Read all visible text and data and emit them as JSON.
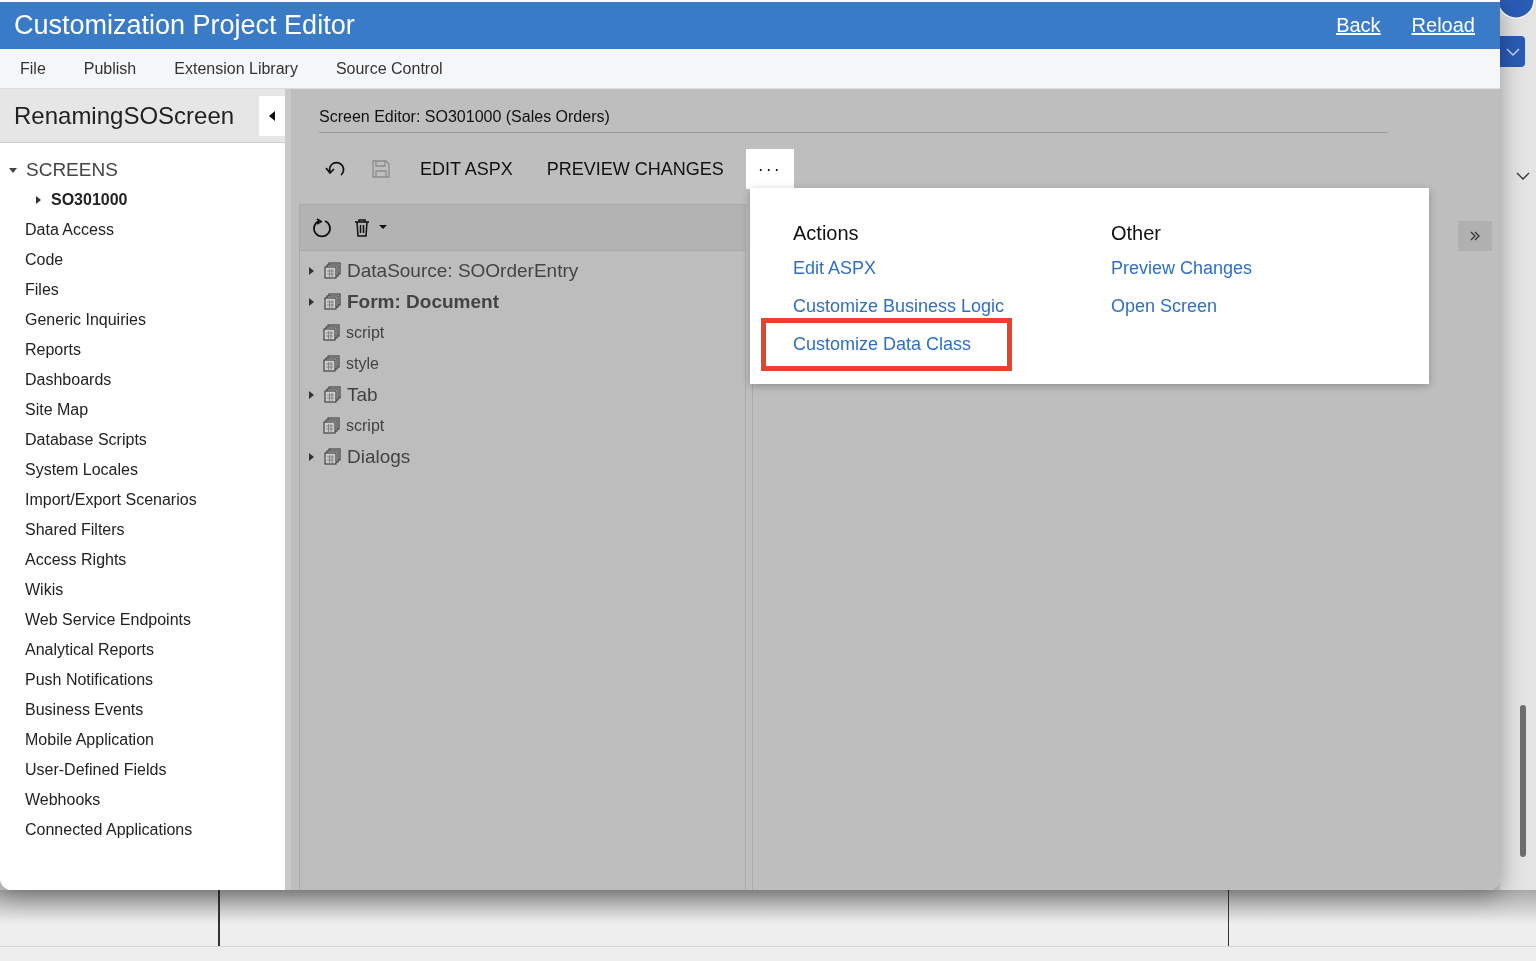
{
  "window": {
    "title": "Customization Project Editor",
    "links": [
      "Back",
      "Reload"
    ]
  },
  "menu": [
    "File",
    "Publish",
    "Extension Library",
    "Source Control"
  ],
  "sidebar": {
    "project": "RenamingSOScreen",
    "items": [
      {
        "label": "SCREENS",
        "expanded": true,
        "children": [
          {
            "label": "SO301000",
            "expanded": false
          }
        ]
      },
      {
        "label": "Data Access"
      },
      {
        "label": "Code"
      },
      {
        "label": "Files"
      },
      {
        "label": "Generic Inquiries"
      },
      {
        "label": "Reports"
      },
      {
        "label": "Dashboards"
      },
      {
        "label": "Site Map"
      },
      {
        "label": "Database Scripts"
      },
      {
        "label": "System Locales"
      },
      {
        "label": "Import/Export Scenarios"
      },
      {
        "label": "Shared Filters"
      },
      {
        "label": "Access Rights"
      },
      {
        "label": "Wikis"
      },
      {
        "label": "Web Service Endpoints"
      },
      {
        "label": "Analytical Reports"
      },
      {
        "label": "Push Notifications"
      },
      {
        "label": "Business Events"
      },
      {
        "label": "Mobile Application"
      },
      {
        "label": "User-Defined Fields"
      },
      {
        "label": "Webhooks"
      },
      {
        "label": "Connected Applications"
      }
    ]
  },
  "editor": {
    "title": "Screen Editor: SO301000 (Sales Orders)",
    "toolbar": [
      {
        "kind": "undo"
      },
      {
        "kind": "save",
        "disabled": true
      },
      {
        "kind": "text",
        "label": "EDIT ASPX"
      },
      {
        "kind": "text",
        "label": "PREVIEW CHANGES"
      },
      {
        "kind": "more",
        "label": "···",
        "selected": true
      }
    ],
    "tree": [
      {
        "label": "DataSource: SOOrderEntry",
        "kind": "branch",
        "bold": false,
        "expanded": false
      },
      {
        "label": "Form: Document",
        "kind": "branch",
        "bold": true,
        "expanded": false
      },
      {
        "label": "script",
        "kind": "leaf",
        "bold": false
      },
      {
        "label": "style",
        "kind": "leaf",
        "bold": false
      },
      {
        "label": "Tab",
        "kind": "branch",
        "bold": false,
        "expanded": false
      },
      {
        "label": "script",
        "kind": "leaf",
        "bold": false
      },
      {
        "label": "Dialogs",
        "kind": "branch",
        "bold": false,
        "expanded": false
      }
    ]
  },
  "popup": {
    "columns": [
      {
        "heading": "Actions",
        "items": [
          {
            "label": "Edit ASPX",
            "highlighted": false
          },
          {
            "label": "Customize Business Logic",
            "highlighted": false
          },
          {
            "label": "Customize Data Class",
            "highlighted": true
          }
        ]
      },
      {
        "heading": "Other",
        "items": [
          {
            "label": "Preview Changes",
            "highlighted": false
          },
          {
            "label": "Open Screen",
            "highlighted": false
          }
        ]
      }
    ]
  }
}
